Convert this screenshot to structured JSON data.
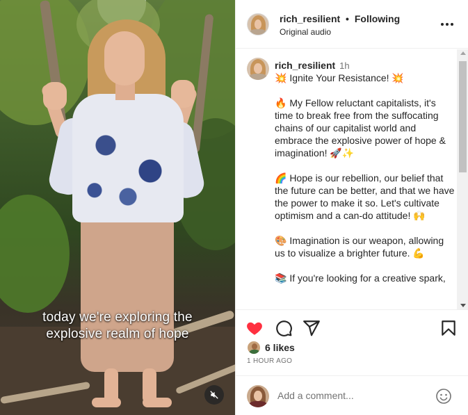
{
  "video": {
    "caption_line1": "today we're exploring the",
    "caption_line2": "explosive realm of hope",
    "muted": true
  },
  "header": {
    "username": "rich_resilient",
    "separator": "•",
    "follow_status": "Following",
    "audio": "Original audio"
  },
  "post": {
    "username": "rich_resilient",
    "time": "1h",
    "paragraphs": [
      "💥 Ignite Your Resistance! 💥",
      "🔥 My Fellow reluctant capitalists, it's time to break free from the suffocating chains of our capitalist world and embrace the explosive power of hope & imagination! 🚀✨",
      "🌈 Hope is our rebellion, our belief that the future can be better, and that we have the power to make it so. Let's cultivate optimism and a can-do attitude! 🙌",
      "🎨 Imagination is our weapon, allowing us to visualize a brighter future. 💪",
      "📚 If you're looking for a creative spark,"
    ]
  },
  "engagement": {
    "likes": "6 likes",
    "timestamp": "1 HOUR AGO",
    "liked": true
  },
  "comment": {
    "placeholder": "Add a comment..."
  },
  "colors": {
    "like_red": "#ff3040",
    "text": "#262626",
    "secondary": "#737373",
    "border": "#efefef"
  }
}
